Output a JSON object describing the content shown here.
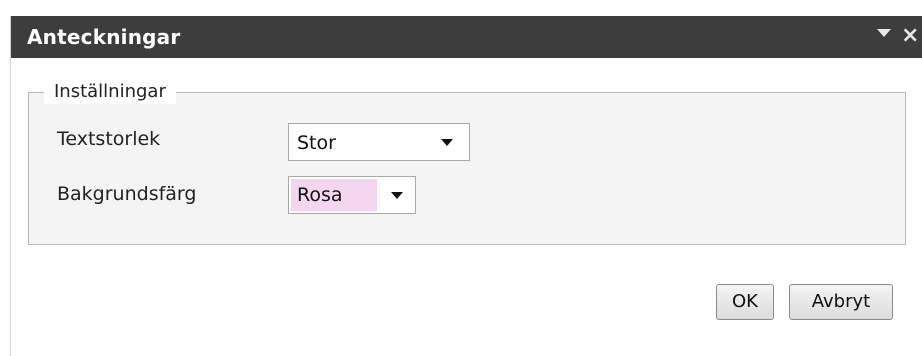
{
  "dialog": {
    "title": "Anteckningar",
    "menu_icon": "chevron-down-icon",
    "close_icon": "close-icon",
    "close_glyph": "×"
  },
  "settings": {
    "legend": "Inställningar",
    "text_size": {
      "label": "Textstorlek",
      "value": "Stor"
    },
    "background_color": {
      "label": "Bakgrundsfärg",
      "value": "Rosa",
      "swatch_color": "#f5d6f0"
    }
  },
  "buttons": {
    "ok": "OK",
    "cancel": "Avbryt"
  },
  "colors": {
    "titlebar": "#3d3d3d",
    "panel_bg": "#f4f4f4"
  }
}
